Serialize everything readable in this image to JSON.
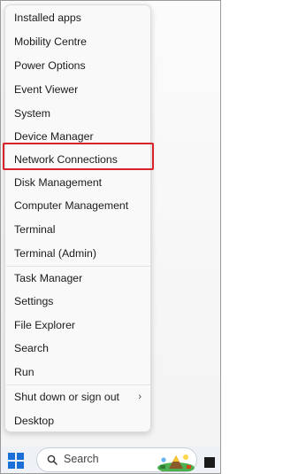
{
  "menu": {
    "items": [
      {
        "label": "Installed apps"
      },
      {
        "label": "Mobility Centre"
      },
      {
        "label": "Power Options"
      },
      {
        "label": "Event Viewer"
      },
      {
        "label": "System"
      },
      {
        "label": "Device Manager"
      },
      {
        "label": "Network Connections"
      },
      {
        "label": "Disk Management",
        "highlighted": true
      },
      {
        "label": "Computer Management"
      },
      {
        "label": "Terminal"
      },
      {
        "label": "Terminal (Admin)"
      },
      {
        "label": "Task Manager"
      },
      {
        "label": "Settings"
      },
      {
        "label": "File Explorer"
      },
      {
        "label": "Search"
      },
      {
        "label": "Run"
      },
      {
        "label": "Shut down or sign out",
        "has_submenu": true,
        "submenu_arrow": "›"
      },
      {
        "label": "Desktop"
      }
    ]
  },
  "highlight_color": "#d8232a",
  "taskbar": {
    "start_icon": "windows-logo-icon",
    "search_icon": "search-icon",
    "search_label": "Search",
    "accent": "#1a6fd8"
  }
}
